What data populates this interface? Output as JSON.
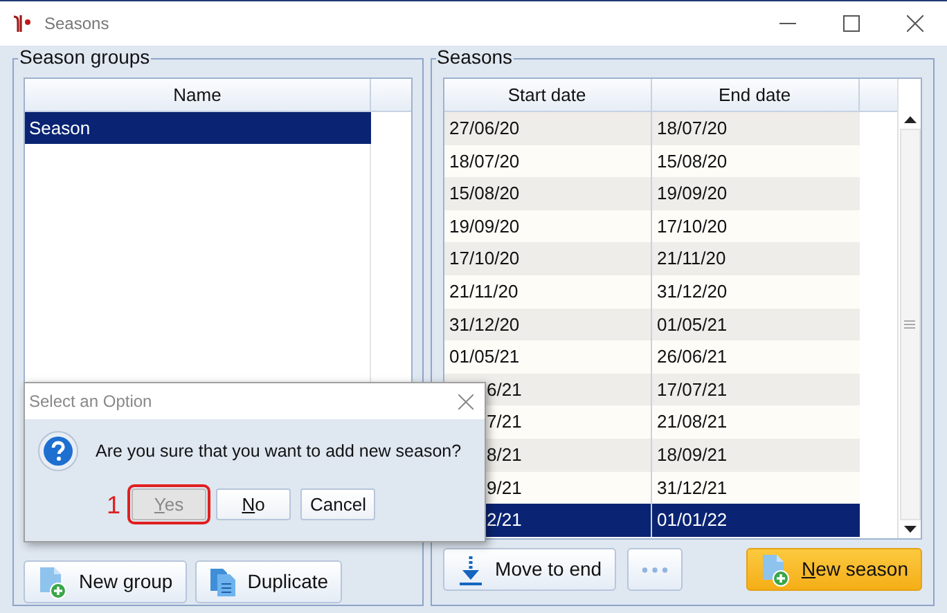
{
  "window": {
    "title": "Seasons"
  },
  "season_groups": {
    "title": "Season groups",
    "columns": [
      "Name"
    ],
    "rows": [
      {
        "name": "Season",
        "selected": true
      }
    ],
    "buttons": [
      {
        "label": "New group",
        "kind": "new"
      },
      {
        "label": "Duplicate",
        "kind": "duplicate"
      }
    ]
  },
  "seasons": {
    "title": "Seasons",
    "columns": [
      "Start date",
      "End date"
    ],
    "rows": [
      {
        "start": "27/06/20",
        "end": "18/07/20",
        "selected": false,
        "covered": false
      },
      {
        "start": "18/07/20",
        "end": "15/08/20",
        "selected": false,
        "covered": false
      },
      {
        "start": "15/08/20",
        "end": "19/09/20",
        "selected": false,
        "covered": false
      },
      {
        "start": "19/09/20",
        "end": "17/10/20",
        "selected": false,
        "covered": false
      },
      {
        "start": "17/10/20",
        "end": "21/11/20",
        "selected": false,
        "covered": false
      },
      {
        "start": "21/11/20",
        "end": "31/12/20",
        "selected": false,
        "covered": false
      },
      {
        "start": "31/12/20",
        "end": "01/05/21",
        "selected": false,
        "covered": false
      },
      {
        "start": "01/05/21",
        "end": "26/06/21",
        "selected": false,
        "covered": false
      },
      {
        "start": "6/21",
        "end": "17/07/21",
        "selected": false,
        "covered": true
      },
      {
        "start": "7/21",
        "end": "21/08/21",
        "selected": false,
        "covered": true
      },
      {
        "start": "8/21",
        "end": "18/09/21",
        "selected": false,
        "covered": true
      },
      {
        "start": "9/21",
        "end": "31/12/21",
        "selected": false,
        "covered": true
      },
      {
        "start": "2/21",
        "end": "01/01/22",
        "selected": true,
        "covered": true
      }
    ],
    "buttons": [
      {
        "label": "Move to end",
        "kind": "move"
      },
      {
        "kind": "more"
      },
      {
        "label": "New season",
        "kind": "primary",
        "mnemonic": true
      }
    ]
  },
  "dialog": {
    "title": "Select an Option",
    "message": "Are you sure that you want to add new season?",
    "step_marker": "1",
    "buttons": [
      {
        "label": "Yes",
        "mnemonic": true,
        "disabled": true,
        "highlighted": true
      },
      {
        "label": "No",
        "mnemonic": true,
        "disabled": false,
        "highlighted": false
      },
      {
        "label": "Cancel",
        "mnemonic": false,
        "disabled": false,
        "highlighted": false
      }
    ]
  }
}
